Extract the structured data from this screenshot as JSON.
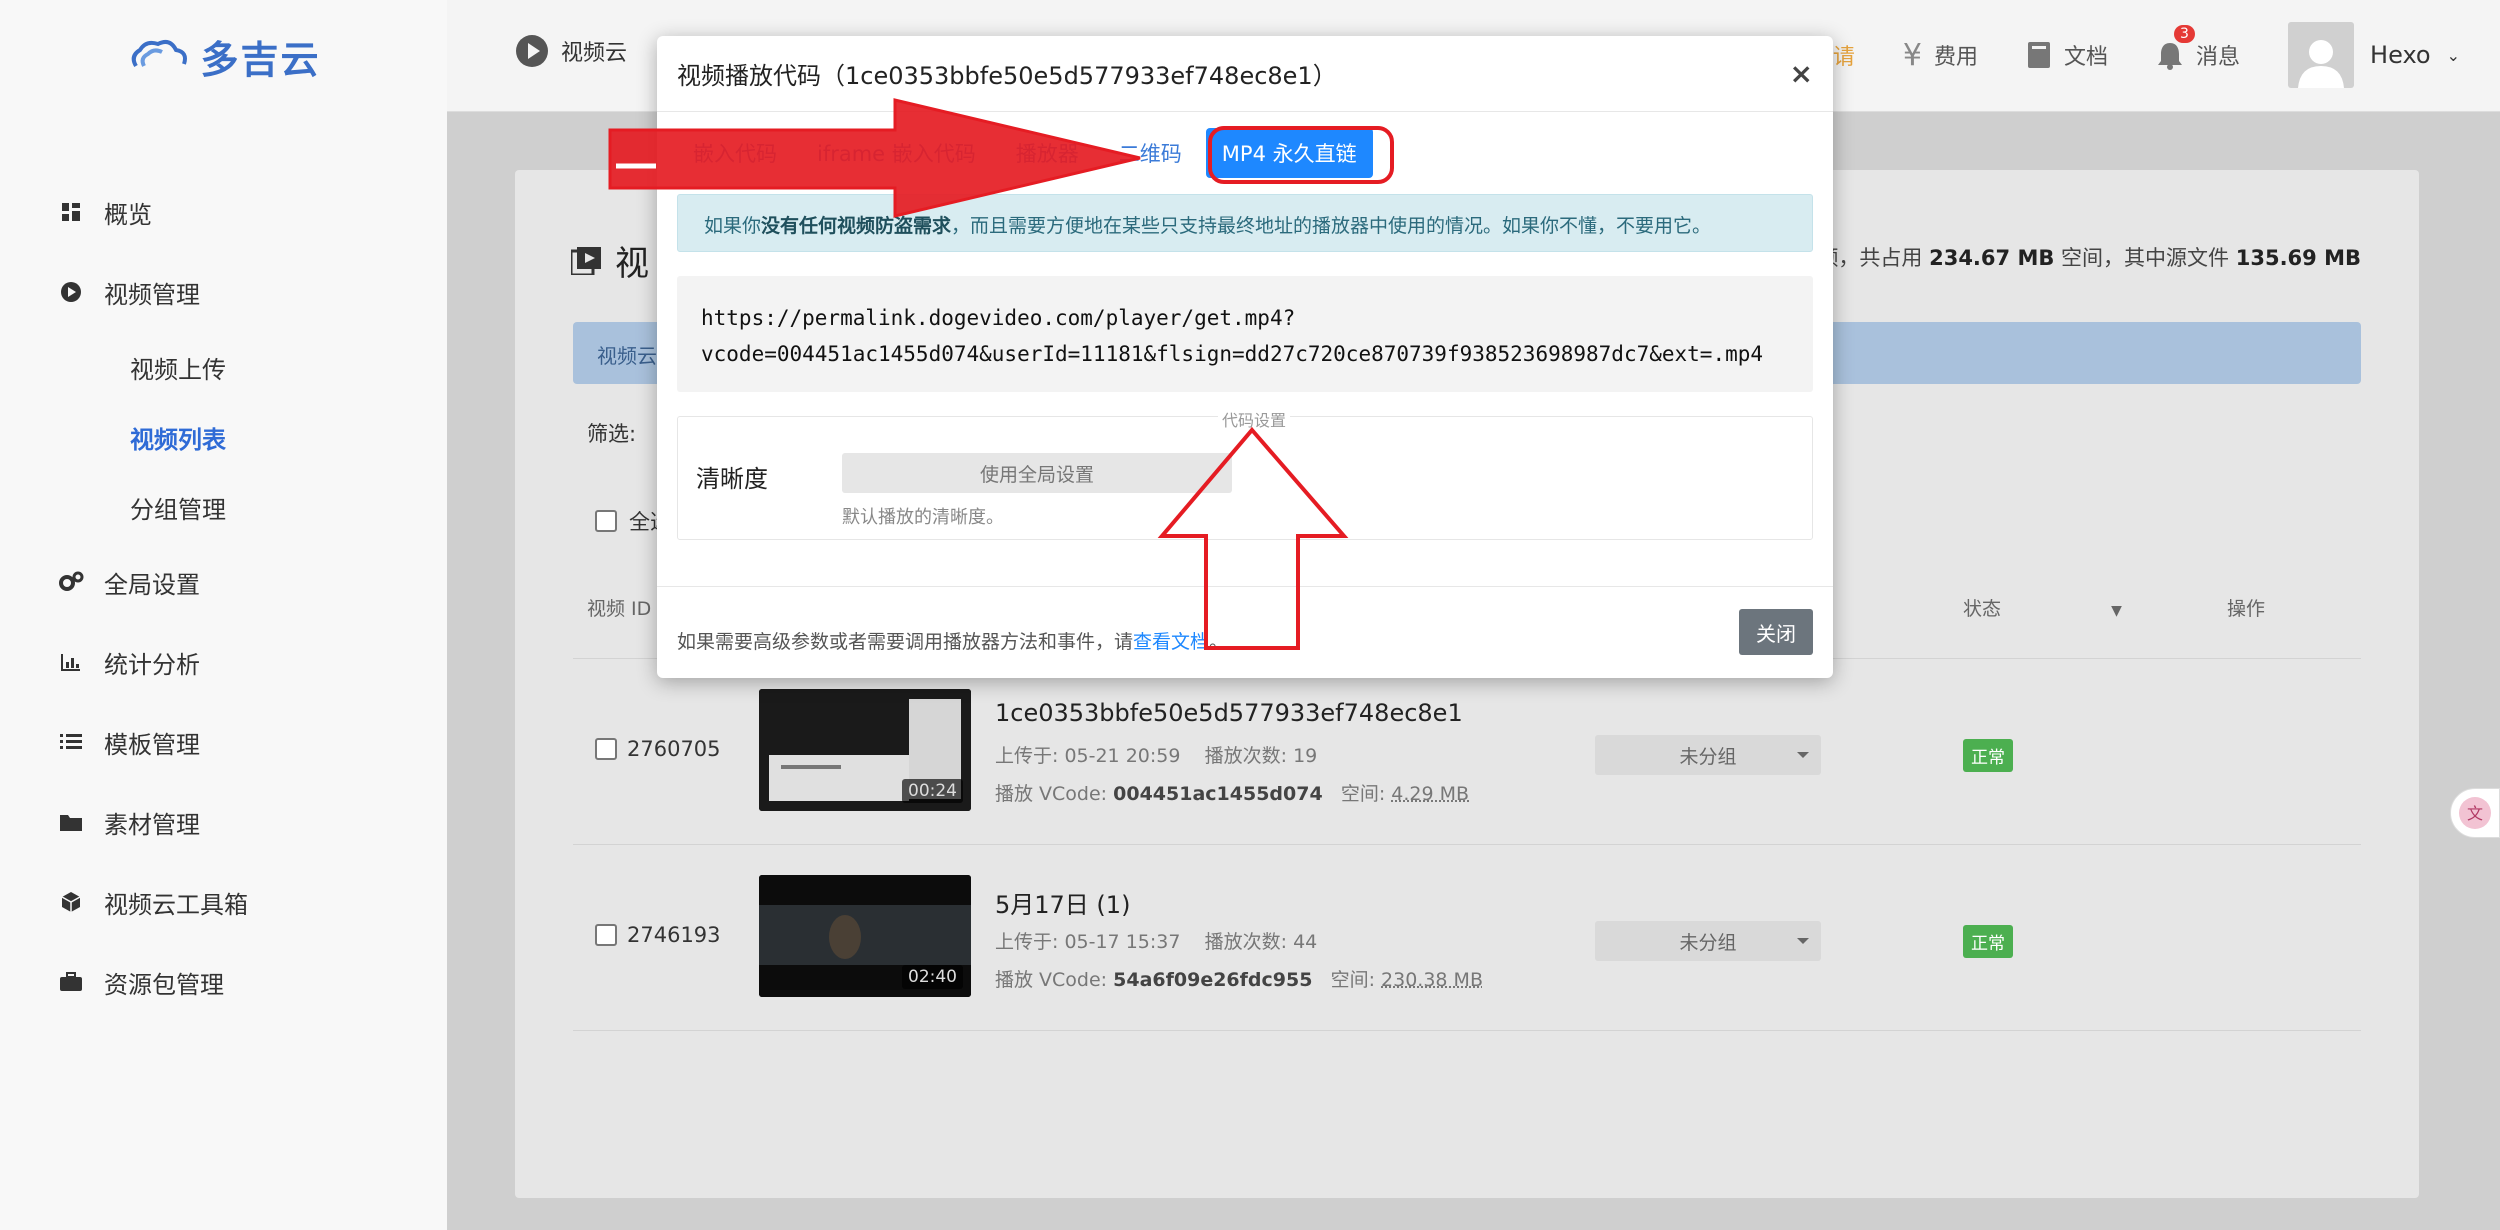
{
  "brand": {
    "name": "多吉云"
  },
  "sidebar": {
    "items": [
      {
        "label": "概览",
        "icon": "dashboard-icon"
      },
      {
        "label": "视频管理",
        "icon": "play-circle-icon"
      },
      {
        "label": "视频上传",
        "sub": true
      },
      {
        "label": "视频列表",
        "sub": true,
        "active": true
      },
      {
        "label": "分组管理",
        "sub": true
      },
      {
        "label": "全局设置",
        "icon": "gears-icon"
      },
      {
        "label": "统计分析",
        "icon": "bar-chart-icon"
      },
      {
        "label": "模板管理",
        "icon": "list-icon"
      },
      {
        "label": "素材管理",
        "icon": "folder-icon"
      },
      {
        "label": "视频云工具箱",
        "icon": "cube-icon"
      },
      {
        "label": "资源包管理",
        "icon": "briefcase-icon"
      }
    ]
  },
  "topbar": {
    "product": "视频云",
    "invite": "邀请",
    "fees": "费用",
    "docs": "文档",
    "messages": "消息",
    "message_count": "3",
    "username": "Hexo"
  },
  "page": {
    "title_char": "视",
    "stats_prefix": "视频，共占用",
    "stats_used": "234.67 MB",
    "stats_mid": "空间，其中源文件",
    "stats_source": "135.69 MB",
    "notice_prefix": "视频云",
    "filter_label": "筛选:",
    "select_all": "全选",
    "col_id": "视频 ID",
    "col_status": "状态",
    "col_ops": "操作"
  },
  "videos": [
    {
      "id": "2760705",
      "title": "1ce0353bbfe50e5d577933ef748ec8e1",
      "uploaded": "上传于: 05-21 20:59",
      "plays": "播放次数: 19",
      "vcode_label": "播放 VCode:",
      "vcode": "004451ac1455d074",
      "space_label": "空间:",
      "space": "4.29 MB",
      "duration": "00:24",
      "group": "未分组",
      "status": "正常"
    },
    {
      "id": "2746193",
      "title": "5月17日 (1)",
      "uploaded": "上传于: 05-17 15:37",
      "plays": "播放次数: 44",
      "vcode_label": "播放 VCode:",
      "vcode": "54a6f09e26fdc955",
      "space_label": "空间:",
      "space": "230.38 MB",
      "duration": "02:40",
      "group": "未分组",
      "status": "正常"
    }
  ],
  "modal": {
    "title": "视频播放代码（1ce0353bbfe50e5d577933ef748ec8e1）",
    "close_symbol": "×",
    "tabs": [
      "嵌入代码",
      "iframe 嵌入代码",
      "播放器",
      "二维码",
      "MP4 永久直链"
    ],
    "info_prefix": "如果你",
    "info_bold": "没有任何视频防盗需求",
    "info_suffix": "，而且需要方便地在某些只支持最终地址的播放器中使用的情况。如果你不懂，不要用它。",
    "code_line1": "https://permalink.dogevideo.com/player/get.mp4?",
    "code_line2": "vcode=004451ac1455d074&userId=11181&flsign=dd27c720ce870739f938523698987dc7&ext=.mp4",
    "settings_legend": "代码设置",
    "quality_label": "清晰度",
    "quality_value": "使用全局设置",
    "quality_hint": "默认播放的清晰度。",
    "footer_prefix": "如果需要高级参数或者需要调用播放器方法和事件，请",
    "footer_link": "查看文档",
    "footer_suffix": "。",
    "close_button": "关闭"
  },
  "colors": {
    "accent": "#1e88ff",
    "brand": "#3b6fc7",
    "annotation": "#e51c23",
    "status_ok": "#4caf50"
  }
}
